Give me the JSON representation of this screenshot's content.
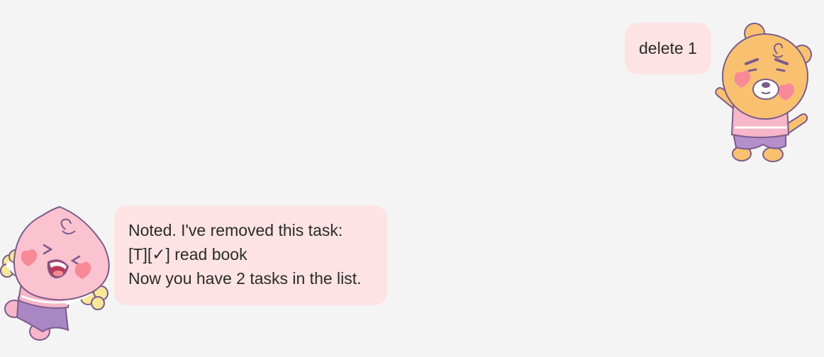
{
  "conversation": {
    "user_message": {
      "text": "delete 1",
      "avatar": "ryan-bear-avatar"
    },
    "bot_message": {
      "lines": [
        "Noted. I've removed this task:",
        "[T][✓] read book",
        "Now you have 2 tasks in the list."
      ],
      "avatar": "apeach-peach-avatar"
    }
  },
  "colors": {
    "background": "#f4f4f4",
    "bubble": "#fde3e4",
    "text": "#2b2b2b"
  }
}
